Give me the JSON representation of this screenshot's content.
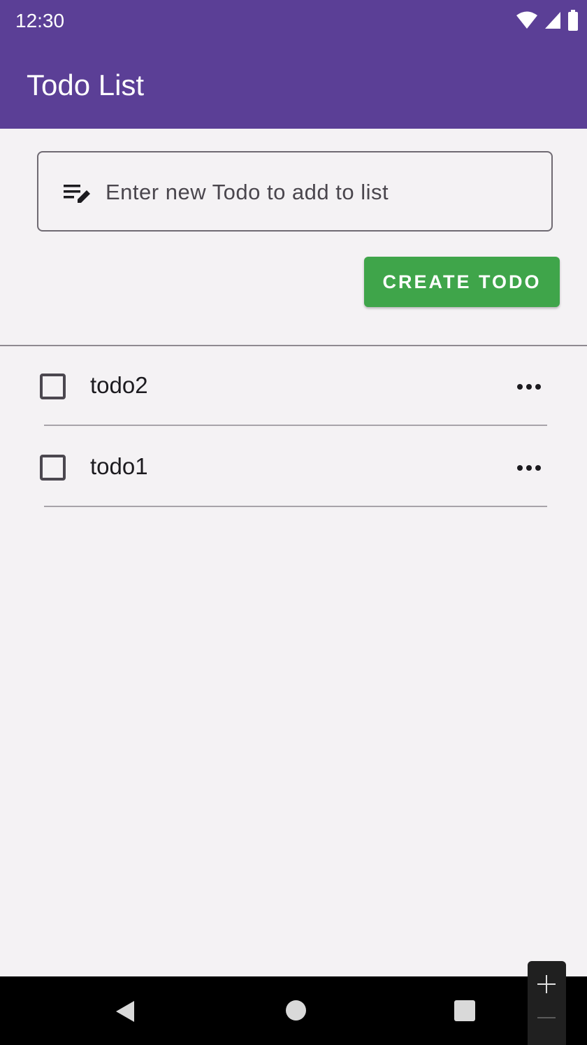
{
  "status_bar": {
    "time": "12:30",
    "icons": [
      "wifi-icon",
      "signal-icon",
      "battery-icon"
    ]
  },
  "app_bar": {
    "title": "Todo List"
  },
  "new_todo": {
    "icon": "edit-note-icon",
    "placeholder": "Enter new Todo to add to list",
    "value": ""
  },
  "create_button": {
    "label": "CREATE TODO"
  },
  "todos": [
    {
      "text": "todo2",
      "checked": false,
      "more_icon": "more-horiz-icon"
    },
    {
      "text": "todo1",
      "checked": false,
      "more_icon": "more-horiz-icon"
    }
  ],
  "nav_bar": {
    "icons": [
      "back-icon",
      "home-icon",
      "recents-icon"
    ]
  },
  "zoom_controls": {
    "icons": [
      "zoom-in-icon",
      "zoom-out-icon"
    ]
  },
  "colors": {
    "app_bar": "#5b3f96",
    "create_button": "#3fa54a",
    "background": "#f4f2f4"
  }
}
